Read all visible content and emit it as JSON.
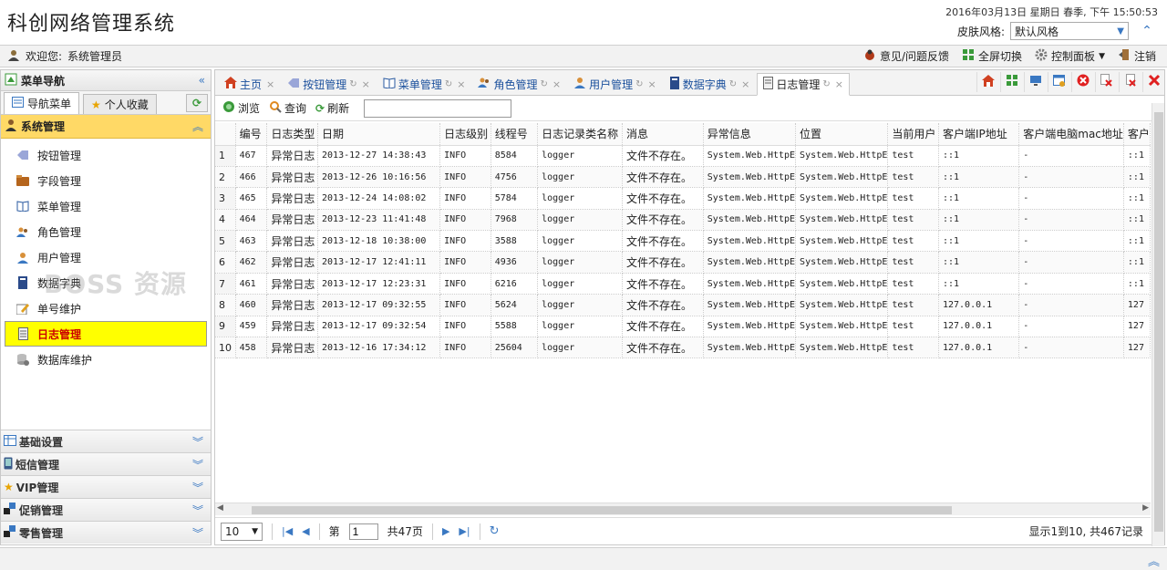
{
  "header": {
    "title": "科创网络管理系统",
    "datetime": "2016年03月13日 星期日 春季, 下午 15:50:53",
    "skin_label": "皮肤风格:",
    "skin_value": "默认风格"
  },
  "topbar": {
    "welcome_label": "欢迎您:",
    "user": "系统管理员",
    "feedback": "意见/问题反馈",
    "fullscreen": "全屏切换",
    "control_panel": "控制面板",
    "logout": "注销"
  },
  "sidebar": {
    "title": "菜单导航",
    "tab_nav": "导航菜单",
    "tab_fav": "个人收藏",
    "active_group": "系统管理",
    "items": [
      {
        "label": "按钮管理"
      },
      {
        "label": "字段管理"
      },
      {
        "label": "菜单管理"
      },
      {
        "label": "角色管理"
      },
      {
        "label": "用户管理"
      },
      {
        "label": "数据字典"
      },
      {
        "label": "单号维护"
      },
      {
        "label": "日志管理"
      },
      {
        "label": "数据库维护"
      }
    ],
    "groups": [
      {
        "label": "基础设置"
      },
      {
        "label": "短信管理"
      },
      {
        "label": "VIP管理"
      },
      {
        "label": "促销管理"
      },
      {
        "label": "零售管理"
      }
    ]
  },
  "tabs": [
    {
      "label": "主页"
    },
    {
      "label": "按钮管理"
    },
    {
      "label": "菜单管理"
    },
    {
      "label": "角色管理"
    },
    {
      "label": "用户管理"
    },
    {
      "label": "数据字典"
    },
    {
      "label": "日志管理"
    }
  ],
  "toolbar": {
    "browse": "浏览",
    "query": "查询",
    "refresh": "刷新"
  },
  "grid": {
    "columns": [
      "编号",
      "日志类型",
      "日期",
      "日志级别",
      "线程号",
      "日志记录类名称",
      "消息",
      "异常信息",
      "位置",
      "当前用户",
      "客户端IP地址",
      "客户端电脑mac地址",
      "客户"
    ],
    "rows": [
      [
        "1",
        "467",
        "异常日志",
        "2013-12-27 14:38:43",
        "INFO",
        "8584",
        "logger",
        "文件不存在。",
        "System.Web.HttpE",
        "System.Web.HttpE",
        "test",
        "::1",
        "-",
        "::1"
      ],
      [
        "2",
        "466",
        "异常日志",
        "2013-12-26 10:16:56",
        "INFO",
        "4756",
        "logger",
        "文件不存在。",
        "System.Web.HttpE",
        "System.Web.HttpE",
        "test",
        "::1",
        "-",
        "::1"
      ],
      [
        "3",
        "465",
        "异常日志",
        "2013-12-24 14:08:02",
        "INFO",
        "5784",
        "logger",
        "文件不存在。",
        "System.Web.HttpE",
        "System.Web.HttpE",
        "test",
        "::1",
        "-",
        "::1"
      ],
      [
        "4",
        "464",
        "异常日志",
        "2013-12-23 11:41:48",
        "INFO",
        "7968",
        "logger",
        "文件不存在。",
        "System.Web.HttpE",
        "System.Web.HttpE",
        "test",
        "::1",
        "-",
        "::1"
      ],
      [
        "5",
        "463",
        "异常日志",
        "2013-12-18 10:38:00",
        "INFO",
        "3588",
        "logger",
        "文件不存在。",
        "System.Web.HttpE",
        "System.Web.HttpE",
        "test",
        "::1",
        "-",
        "::1"
      ],
      [
        "6",
        "462",
        "异常日志",
        "2013-12-17 12:41:11",
        "INFO",
        "4936",
        "logger",
        "文件不存在。",
        "System.Web.HttpE",
        "System.Web.HttpE",
        "test",
        "::1",
        "-",
        "::1"
      ],
      [
        "7",
        "461",
        "异常日志",
        "2013-12-17 12:23:31",
        "INFO",
        "6216",
        "logger",
        "文件不存在。",
        "System.Web.HttpE",
        "System.Web.HttpE",
        "test",
        "::1",
        "-",
        "::1"
      ],
      [
        "8",
        "460",
        "异常日志",
        "2013-12-17 09:32:55",
        "INFO",
        "5624",
        "logger",
        "文件不存在。",
        "System.Web.HttpE",
        "System.Web.HttpE",
        "test",
        "127.0.0.1",
        "-",
        "127"
      ],
      [
        "9",
        "459",
        "异常日志",
        "2013-12-17 09:32:54",
        "INFO",
        "5588",
        "logger",
        "文件不存在。",
        "System.Web.HttpE",
        "System.Web.HttpE",
        "test",
        "127.0.0.1",
        "-",
        "127"
      ],
      [
        "10",
        "458",
        "异常日志",
        "2013-12-16 17:34:12",
        "INFO",
        "25604",
        "logger",
        "文件不存在。",
        "System.Web.HttpE",
        "System.Web.HttpE",
        "test",
        "127.0.0.1",
        "-",
        "127"
      ]
    ]
  },
  "pager": {
    "page_size": "10",
    "page_prefix": "第",
    "page_value": "1",
    "total_pages": "共47页",
    "info": "显示1到10, 共467记录"
  },
  "watermark": "BOSS 资源"
}
